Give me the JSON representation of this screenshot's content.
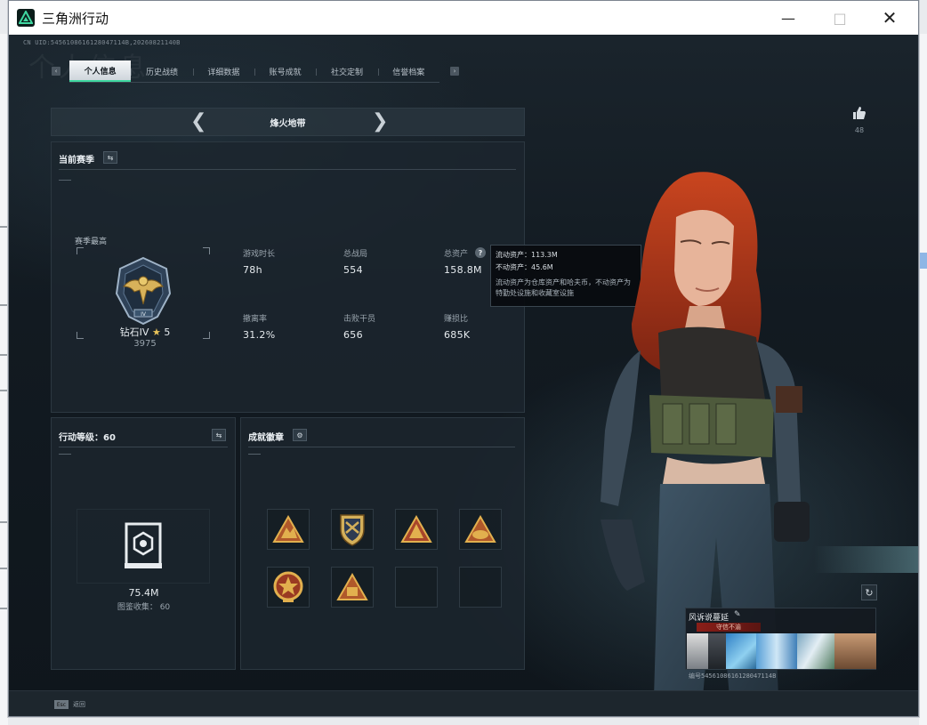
{
  "window": {
    "title": "三角洲行动"
  },
  "header": {
    "uid": "CN UID:5456108616128047114B,20260821140B",
    "watermark": "个人信息"
  },
  "tabs": [
    {
      "label": "个人信息",
      "active": true
    },
    {
      "label": "历史战绩",
      "active": false
    },
    {
      "label": "详细数据",
      "active": false
    },
    {
      "label": "账号成就",
      "active": false
    },
    {
      "label": "社交定制",
      "active": false
    },
    {
      "label": "信誉档案",
      "active": false
    }
  ],
  "mode": {
    "label": "烽火地带"
  },
  "season": {
    "title": "当前赛季",
    "best_label": "赛季最高",
    "rank_name": "钻石IV",
    "rank_stars": "5",
    "rank_score": "3975",
    "stats": [
      {
        "label": "游戏时长",
        "value": "78h"
      },
      {
        "label": "总战局",
        "value": "554"
      },
      {
        "label": "总资产",
        "value": "158.8M"
      },
      {
        "label": "撤离率",
        "value": "31.2%"
      },
      {
        "label": "击败干员",
        "value": "656"
      },
      {
        "label": "赚损比",
        "value": "685K"
      }
    ]
  },
  "tooltip": {
    "liquid": "流动资产：113.3M",
    "fixed": "不动资产：45.6M",
    "desc": "流动资产为仓库资产和哈夫币，不动资产为特勤处设施和收藏室设施"
  },
  "level": {
    "title": "行动等级：60",
    "value": "75.4M",
    "collect_label": "图鉴收集： 60"
  },
  "badges": {
    "title": "成就徽章"
  },
  "like": {
    "count": "48"
  },
  "card": {
    "name": "风诉说蔓延",
    "tag": "守信不渝",
    "id": "编号5456108616128047114B"
  },
  "footer": {
    "esc_key": "Esc",
    "esc_label": "返回"
  },
  "colors": {
    "accent": "#3fd7a0",
    "tab_active": "#f4f6f8",
    "bg": "#121920"
  }
}
